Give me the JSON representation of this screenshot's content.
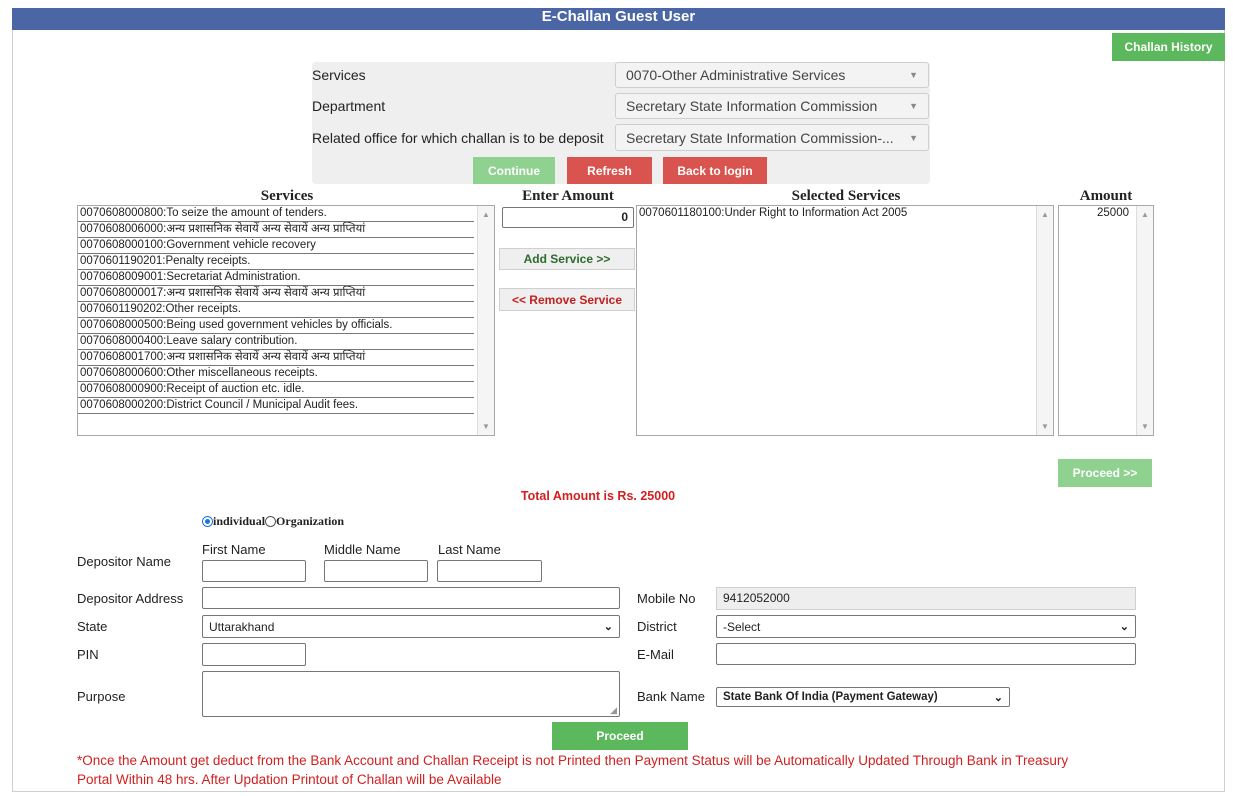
{
  "header": {
    "title": "E-Challan Guest User"
  },
  "top_buttons": {
    "challan_history": "Challan History"
  },
  "filters": {
    "services_label": "Services",
    "services_value": "0070-Other Administrative Services",
    "department_label": "Department",
    "department_value": "Secretary State Information Commission",
    "office_label": "Related office for which challan is to be deposit",
    "office_value": "Secretary State Information Commission-...",
    "continue": "Continue",
    "refresh": "Refresh",
    "back": "Back to login"
  },
  "columns": {
    "services": "Services",
    "enter_amount": "Enter Amount",
    "selected_services": "Selected Services",
    "amount": "Amount"
  },
  "services_list": [
    "0070608000800:To seize the amount of tenders.",
    "0070608006000:अन्य प्रशासनिक सेवायें अन्य सेवायें अन्य प्राप्तियां",
    "0070608000100:Government vehicle recovery",
    "0070601190201:Penalty receipts.",
    "0070608009001:Secretariat Administration.",
    "0070608000017:अन्य प्रशासनिक सेवायें अन्य सेवायें अन्य प्राप्तियां",
    "0070601190202:Other receipts.",
    "0070608000500:Being used government vehicles by officials.",
    "0070608000400:Leave salary contribution.",
    "0070608001700:अन्य प्रशासनिक सेवायें अन्य सेवायें अन्य प्राप्तियां",
    "0070608000600:Other miscellaneous receipts.",
    "0070608000900:Receipt of auction etc. idle.",
    "0070608000200:District Council / Municipal Audit fees."
  ],
  "enter_amount_value": "0",
  "add_service": "Add Service >>",
  "remove_service": "<< Remove Service",
  "selected_list": [
    "0070601180100:Under Right to Information Act 2005"
  ],
  "amount_list": [
    "25000"
  ],
  "proceed_top": "Proceed >>",
  "total_text": "Total Amount is Rs. 25000",
  "depositor_type": {
    "individual": "individual",
    "organization": "Organization"
  },
  "form": {
    "depositor_name": "Depositor Name",
    "first_name": "First Name",
    "middle_name": "Middle Name",
    "last_name": "Last Name",
    "depositor_address": "Depositor Address",
    "mobile_label": "Mobile No",
    "mobile_value": "9412052000",
    "state_label": "State",
    "state_value": "Uttarakhand",
    "district_label": "District",
    "district_value": "-Select",
    "pin_label": "PIN",
    "email_label": "E-Mail",
    "purpose_label": "Purpose",
    "bank_label": "Bank Name",
    "bank_value": "State Bank Of India (Payment Gateway)"
  },
  "proceed_bottom": "Proceed",
  "note_line1": "*Once the Amount get deduct from the Bank Account and Challan Receipt is not Printed then Payment Status will be Automatically Updated Through Bank in Treasury",
  "note_line2": "Portal Within 48 hrs. After Updation Printout of Challan will be Available"
}
